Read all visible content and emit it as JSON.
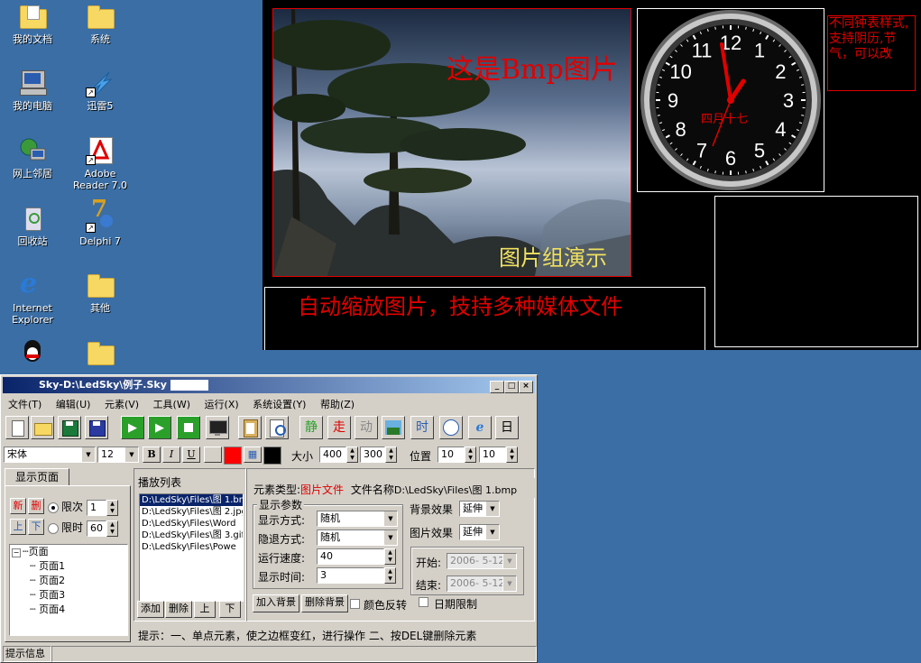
{
  "desktop_icons": [
    {
      "label": "我的文档",
      "icon": "my-documents-icon"
    },
    {
      "label": "系统",
      "icon": "folder-icon"
    },
    {
      "label": "我的电脑",
      "icon": "my-computer-icon"
    },
    {
      "label": "迅雷5",
      "icon": "thunder-icon"
    },
    {
      "label": "网上邻居",
      "icon": "network-icon"
    },
    {
      "label": "Adobe Reader 7.0",
      "icon": "adobe-reader-icon"
    },
    {
      "label": "回收站",
      "icon": "recycle-bin-icon"
    },
    {
      "label": "Delphi 7",
      "icon": "delphi-icon"
    },
    {
      "label": "Internet Explorer",
      "icon": "ie-icon"
    },
    {
      "label": "其他",
      "icon": "folder-icon"
    }
  ],
  "led": {
    "bmp_text": "这是Bmp图片",
    "group_text": "图片组演示",
    "scroll_text": "自动缩放图片，技持多种媒体文件",
    "clock_lunar": "四月十七",
    "clock_note": "不同钟表样式,支持阴历,节气，可以改",
    "clock_numbers": [
      "12",
      "1",
      "2",
      "3",
      "4",
      "5",
      "6",
      "7",
      "8",
      "9",
      "10",
      "11"
    ],
    "red": "#e00000",
    "yellow": "#f0e060"
  },
  "window": {
    "title": "Sky-D:\\LedSky\\例子.Sky",
    "menu": [
      "文件(T)",
      "编辑(U)",
      "元素(V)",
      "工具(W)",
      "运行(X)",
      "系统设置(Y)",
      "帮助(Z)"
    ],
    "toolbar_text_buttons": [
      "静",
      "走",
      "动",
      "时",
      "日"
    ],
    "font": {
      "name": "宋体",
      "size": "12",
      "bold": "B",
      "italic": "I",
      "underline": "U"
    },
    "size_label": "大小",
    "width": "400",
    "height": "300",
    "pos_label": "位置",
    "pos_x": "10",
    "pos_y": "10",
    "tab_label": "显示页面",
    "page_new": "新",
    "page_del": "删",
    "page_up": "上",
    "page_down": "下",
    "limit_count_label": "限次",
    "limit_count": "1",
    "limit_time_label": "限时",
    "limit_time": "60",
    "tree_root": "页面",
    "pages": [
      "页面1",
      "页面2",
      "页面3",
      "页面4"
    ],
    "playlist_title": "播放列表",
    "playlist": [
      "D:\\LedSky\\Files\\图 1.bmp",
      "D:\\LedSky\\Files\\图 2.jpg",
      "D:\\LedSky\\Files\\Word",
      "D:\\LedSky\\Files\\图 3.gif",
      "D:\\LedSky\\Files\\Powe"
    ],
    "btn_add": "添加",
    "btn_delete": "删除",
    "btn_up": "上",
    "btn_down": "下",
    "elem_type_label": "元素类型:",
    "elem_type": "图片文件",
    "file_name_label": "文件名称",
    "file_name": "D:\\LedSky\\Files\\图 1.bmp",
    "display_params": "显示参数",
    "show_mode_label": "显示方式:",
    "show_mode": "随机",
    "hide_mode_label": "隐退方式:",
    "hide_mode": "随机",
    "speed_label": "运行速度:",
    "speed": "40",
    "show_time_label": "显示时间:",
    "show_time": "3",
    "bg_effect_label": "背景效果",
    "bg_effect": "延伸",
    "pic_effect_label": "图片效果",
    "pic_effect": "延伸",
    "start_label": "开始:",
    "start_date": "2006- 5-12",
    "end_label": "结束:",
    "end_date": "2006- 5-12",
    "date_limit": "日期限制",
    "btn_add_bg": "加入背景",
    "btn_del_bg": "删除背景",
    "color_invert": "颜色反转",
    "hint": "提示：一、单点元素，使之边框变红，进行操作 二、按DEL键删除元素",
    "status": "提示信息"
  }
}
